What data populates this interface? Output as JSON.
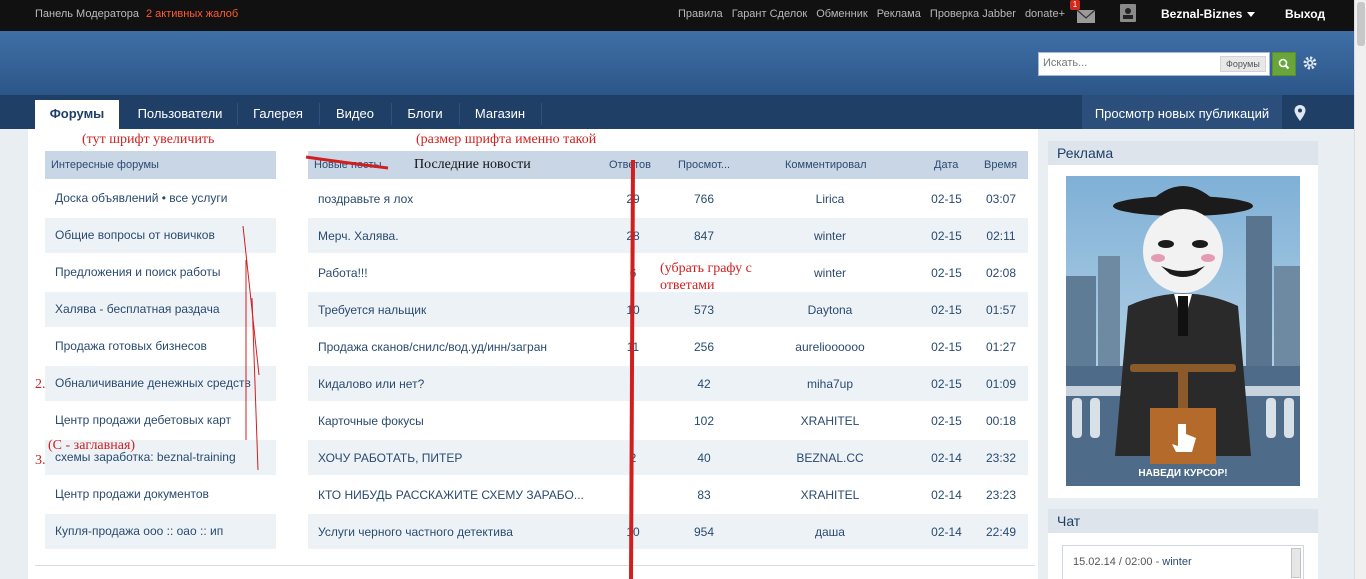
{
  "topbar": {
    "mod_panel": "Панель Модератора",
    "complaints": "2 активных жалоб",
    "links": [
      "Правила",
      "Гарант Сделок",
      "Обменник",
      "Реклама",
      "Проверка Jabber",
      "donate+"
    ],
    "mail_badge": "1",
    "username": "Beznal-Biznes",
    "logout": "Выход"
  },
  "search": {
    "placeholder": "Искать...",
    "scope": "Форумы"
  },
  "nav": {
    "tabs": [
      "Форумы",
      "Пользователи",
      "Галерея",
      "Видео",
      "Блоги",
      "Магазин"
    ],
    "active": "Форумы",
    "new_posts": "Просмотр новых публикаций"
  },
  "forums": {
    "header": "Интересные форумы",
    "items": [
      "Доска объявлений • все услуги",
      "Общие вопросы от новичков",
      "Предложения и поиск работы",
      "Халява - бесплатная раздача",
      "Продажа готовых бизнесов",
      "Обналичивание денежных средств",
      "Центр продажи дебетовых карт",
      "схемы заработка: beznal-training",
      "Центр продажи документов",
      "Купля-продажа ооо :: оао :: ип"
    ]
  },
  "news": {
    "columns": {
      "title": "Новые посты",
      "replies": "Ответов",
      "views": "Просмот...",
      "commented": "Комментировал",
      "date": "Дата",
      "time": "Время"
    },
    "rows": [
      {
        "title": "поздравьте я лох",
        "replies": "29",
        "views": "766",
        "user": "Lirica",
        "date": "02-15",
        "time": "03:07"
      },
      {
        "title": "Мерч. Халява.",
        "replies": "28",
        "views": "847",
        "user": "winter",
        "date": "02-15",
        "time": "02:11"
      },
      {
        "title": "Работа!!!",
        "replies": "6",
        "views": "",
        "user": "winter",
        "date": "02-15",
        "time": "02:08"
      },
      {
        "title": "Требуется нальщик",
        "replies": "10",
        "views": "573",
        "user": "Daytona",
        "date": "02-15",
        "time": "01:57"
      },
      {
        "title": "Продажа сканов/снилс/вод.уд/инн/загран",
        "replies": "11",
        "views": "256",
        "user": "aurelioooooo",
        "date": "02-15",
        "time": "01:27"
      },
      {
        "title": "Кидалово или нет?",
        "replies": "",
        "views": "42",
        "user": "miha7up",
        "date": "02-15",
        "time": "01:09"
      },
      {
        "title": "Карточные фокусы",
        "replies": "",
        "views": "102",
        "user": "XRAHITEL",
        "date": "02-15",
        "time": "00:18"
      },
      {
        "title": "ХОЧУ РАБОТАТЬ, ПИТЕР",
        "replies": "2",
        "views": "40",
        "user": "BEZNAL.CC",
        "date": "02-14",
        "time": "23:32"
      },
      {
        "title": "КТО НИБУДЬ РАССКАЖИТЕ СХЕМУ ЗАРАБО...",
        "replies": "",
        "views": "83",
        "user": "XRAHITEL",
        "date": "02-14",
        "time": "23:23"
      },
      {
        "title": "Услуги черного частного детектива",
        "replies": "10",
        "views": "954",
        "user": "даша",
        "date": "02-14",
        "time": "22:49"
      }
    ]
  },
  "sidebar": {
    "ads_title": "Реклама",
    "banner_caption": "НАВЕДИ КУРСОР!",
    "chat_title": "Чат",
    "chat_time": "15.02.14 / 02:00",
    "chat_sep": " - ",
    "chat_user": "winter"
  },
  "annotations": {
    "font_bigger": "(тут шрифт увеличить",
    "font_size_exact": "(размер шрифта именно такой",
    "news_title": "Последние новости",
    "remove_column_1": "(убрать графу с",
    "remove_column_2": "ответами",
    "capital_c": "(С - заглавная)",
    "num_2": "2.",
    "num_3": "3."
  },
  "colors": {
    "topbar": "#111111",
    "header": "#2c5689",
    "nav": "#1f3f66",
    "complaints": "#ff5a36",
    "annotation": "#d11f1f",
    "search_button": "#6aa53c"
  }
}
